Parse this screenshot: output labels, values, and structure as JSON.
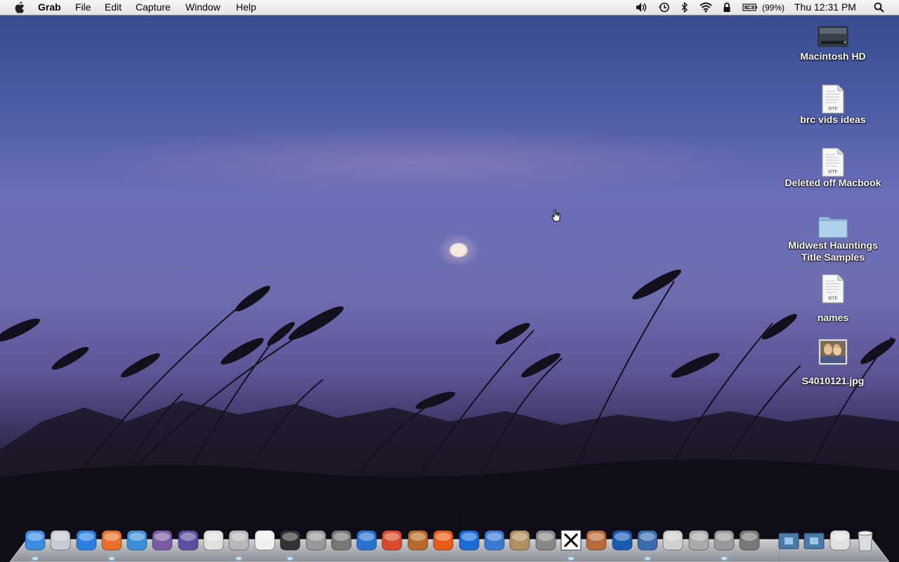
{
  "menubar": {
    "app_name": "Grab",
    "menus": [
      "File",
      "Edit",
      "Capture",
      "Window",
      "Help"
    ],
    "battery": "(99%)",
    "clock": "Thu 12:31 PM",
    "status_icons": [
      "volume-icon",
      "time-machine-icon",
      "bluetooth-icon",
      "wifi-icon",
      "lock-icon",
      "battery-icon",
      "spotlight-icon"
    ]
  },
  "desktop": {
    "icons": [
      {
        "label": "Macintosh HD",
        "icon": "hard-drive-icon"
      },
      {
        "label": "brc vids ideas",
        "icon": "rtf-document-icon"
      },
      {
        "label": "Deleted off Macbook",
        "icon": "rtf-document-icon"
      },
      {
        "label_line1": "Midwest Hauntings",
        "label_line2": "Title Samples",
        "icon": "folder-icon"
      },
      {
        "label": "names",
        "icon": "rtf-document-icon"
      },
      {
        "label": "S4010121.jpg",
        "icon": "photo-thumbnail-icon"
      }
    ],
    "rtf_tag": "RTF"
  },
  "dock": {
    "items": [
      {
        "name": "finder",
        "color": "#3c8de0"
      },
      {
        "name": "mail",
        "color": "#c8ccd2"
      },
      {
        "name": "itunes",
        "color": "#2a7fe0"
      },
      {
        "name": "firefox",
        "color": "#e8702a"
      },
      {
        "name": "safari",
        "color": "#3b8fd8"
      },
      {
        "name": "tor",
        "color": "#7a5aa0"
      },
      {
        "name": "dvd-player",
        "color": "#5a4fa0"
      },
      {
        "name": "script-editor",
        "color": "#e0e0e0"
      },
      {
        "name": "calculator",
        "color": "#b8b8b8"
      },
      {
        "name": "textedit",
        "color": "#f0f0f0"
      },
      {
        "name": "final-cut",
        "color": "#333"
      },
      {
        "name": "motion",
        "color": "#999"
      },
      {
        "name": "imovie-star",
        "color": "#777"
      },
      {
        "name": "idvd",
        "color": "#2a70d0"
      },
      {
        "name": "cocktail",
        "color": "#d84a2a"
      },
      {
        "name": "garageband",
        "color": "#b86a2a"
      },
      {
        "name": "audacity",
        "color": "#e85a1a"
      },
      {
        "name": "quicktime",
        "color": "#1a6ad8"
      },
      {
        "name": "iphoto",
        "color": "#3a7ad0"
      },
      {
        "name": "preview",
        "color": "#b09060"
      },
      {
        "name": "gimp",
        "color": "#888"
      },
      {
        "name": "x11",
        "color": "#f0f0f0"
      },
      {
        "name": "image-capture",
        "color": "#b86a3a"
      },
      {
        "name": "photo-booth",
        "color": "#1a5ab0"
      },
      {
        "name": "photo-viewer",
        "color": "#3a6ab0"
      },
      {
        "name": "migration",
        "color": "#d0d0d0"
      },
      {
        "name": "disk-utility",
        "color": "#aaa"
      },
      {
        "name": "system-preferences",
        "color": "#999"
      },
      {
        "name": "directory-utility",
        "color": "#777"
      },
      {
        "name": "applications-folder",
        "color": "#4a7aa8"
      },
      {
        "name": "documents-folder",
        "color": "#4a7aa8"
      },
      {
        "name": "downloads-stack",
        "color": "#e0e0e0"
      },
      {
        "name": "trash",
        "color": "#bbb"
      }
    ]
  },
  "colors": {
    "menubar": "#ececec",
    "accent": "#2a7fe0"
  }
}
